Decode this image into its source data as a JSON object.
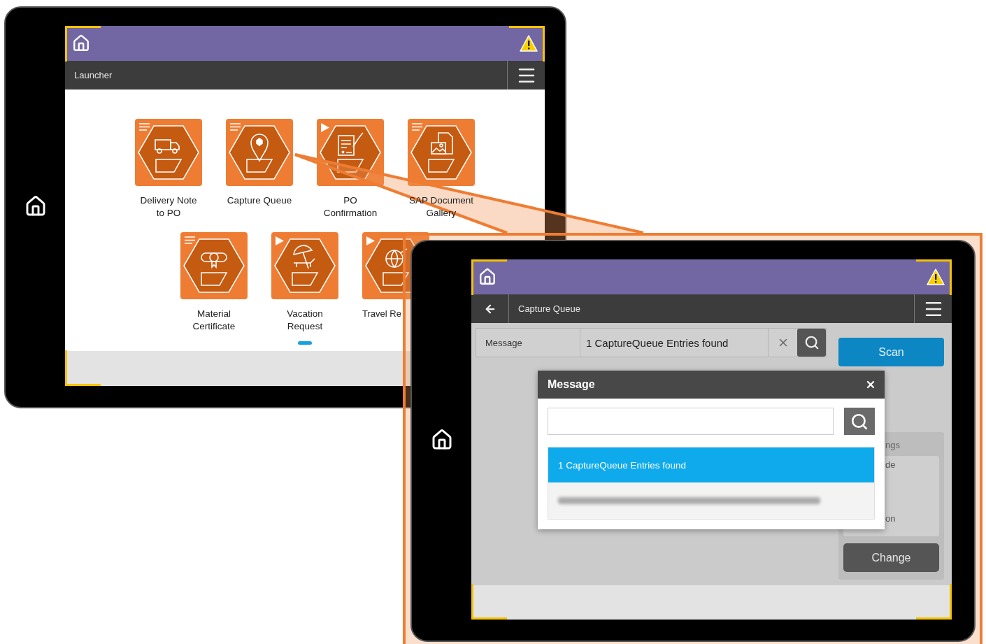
{
  "launcher_screen": {
    "title": "Launcher",
    "apps": [
      {
        "label": "Delivery Note\nto PO",
        "kind": "menu",
        "cut": false
      },
      {
        "label": "Capture Queue",
        "kind": "menu",
        "cut": false
      },
      {
        "label": "PO\nConfirmation",
        "kind": "play",
        "cut": false
      },
      {
        "label": "SAP Document\nGallery",
        "kind": "menu",
        "cut": false
      },
      {
        "label": "Material\nCertificate",
        "kind": "menu",
        "cut": false
      },
      {
        "label": "Vacation\nRequest",
        "kind": "play",
        "cut": false
      },
      {
        "label": "Travel Re",
        "kind": "play",
        "cut": true
      }
    ]
  },
  "capture_screen": {
    "title": "Capture Queue",
    "field": {
      "label": "Message",
      "value": "1 CaptureQueue Entries found"
    },
    "scan_button": "Scan",
    "settings_panel": {
      "heading": "ngs",
      "lines": [
        "de",
        "on"
      ],
      "button": "Change"
    },
    "dialog": {
      "title": "Message",
      "results": [
        {
          "kind": "text",
          "text": "1 CaptureQueue Entries found",
          "selected": true
        },
        {
          "kind": "blurred",
          "selected": false
        }
      ]
    }
  }
}
